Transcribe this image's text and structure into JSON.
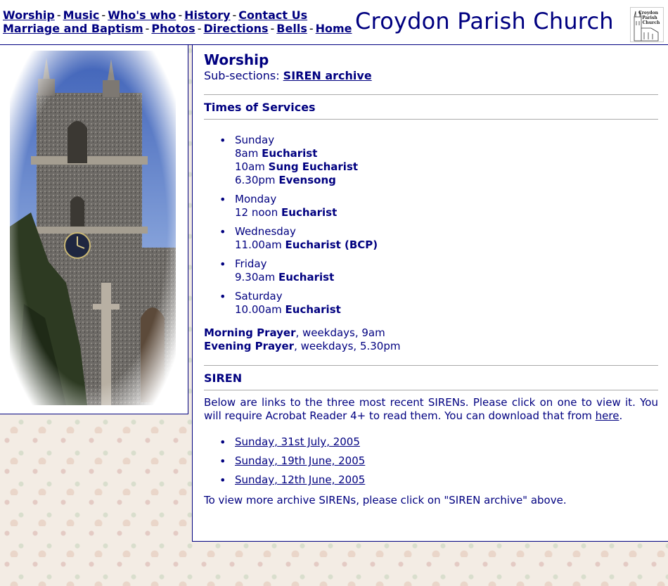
{
  "nav": {
    "row1": [
      "Worship",
      "Music",
      "Who's who",
      "History",
      "Contact Us"
    ],
    "row2": [
      "Marriage and Baptism",
      "Photos",
      "Directions",
      "Bells",
      "Home"
    ],
    "separator": "-"
  },
  "site_title": "Croydon Parish Church",
  "logo_text": "Croydon Parish Church",
  "page": {
    "heading": "Worship",
    "subsections_label": "Sub-sections:",
    "subsection_link": "SIREN archive"
  },
  "services": {
    "heading": "Times of Services",
    "days": [
      {
        "day": "Sunday",
        "items": [
          {
            "time": "8am",
            "service": "Eucharist"
          },
          {
            "time": "10am",
            "service": "Sung Eucharist"
          },
          {
            "time": "6.30pm",
            "service": "Evensong"
          }
        ]
      },
      {
        "day": "Monday",
        "items": [
          {
            "time": "12 noon",
            "service": "Eucharist"
          }
        ]
      },
      {
        "day": "Wednesday",
        "items": [
          {
            "time": "11.00am",
            "service": "Eucharist (BCP)"
          }
        ]
      },
      {
        "day": "Friday",
        "items": [
          {
            "time": "9.30am",
            "service": "Eucharist"
          }
        ]
      },
      {
        "day": "Saturday",
        "items": [
          {
            "time": "10.00am",
            "service": "Eucharist"
          }
        ]
      }
    ],
    "prayers": [
      {
        "name": "Morning Prayer",
        "detail": ", weekdays, 9am"
      },
      {
        "name": "Evening Prayer",
        "detail": ", weekdays, 5.30pm"
      }
    ]
  },
  "siren": {
    "heading": "SIREN",
    "intro_before": "Below are links to the three most recent SIRENs. Please click on one to view it. You will require Acrobat Reader 4+ to read them. You can download that from ",
    "intro_link": "here",
    "intro_after": ".",
    "links": [
      "Sunday, 31st July, 2005",
      "Sunday, 19th June, 2005",
      "Sunday, 12th June, 2005"
    ],
    "footer": "To view more archive SIRENs, please click on \"SIREN archive\" above."
  },
  "colors": {
    "text": "#000080",
    "rule": "#aaaaaa",
    "background": "#f3ece4"
  },
  "images": {
    "photo": "church-tower-photo",
    "logo": "church-logo-sketch"
  }
}
